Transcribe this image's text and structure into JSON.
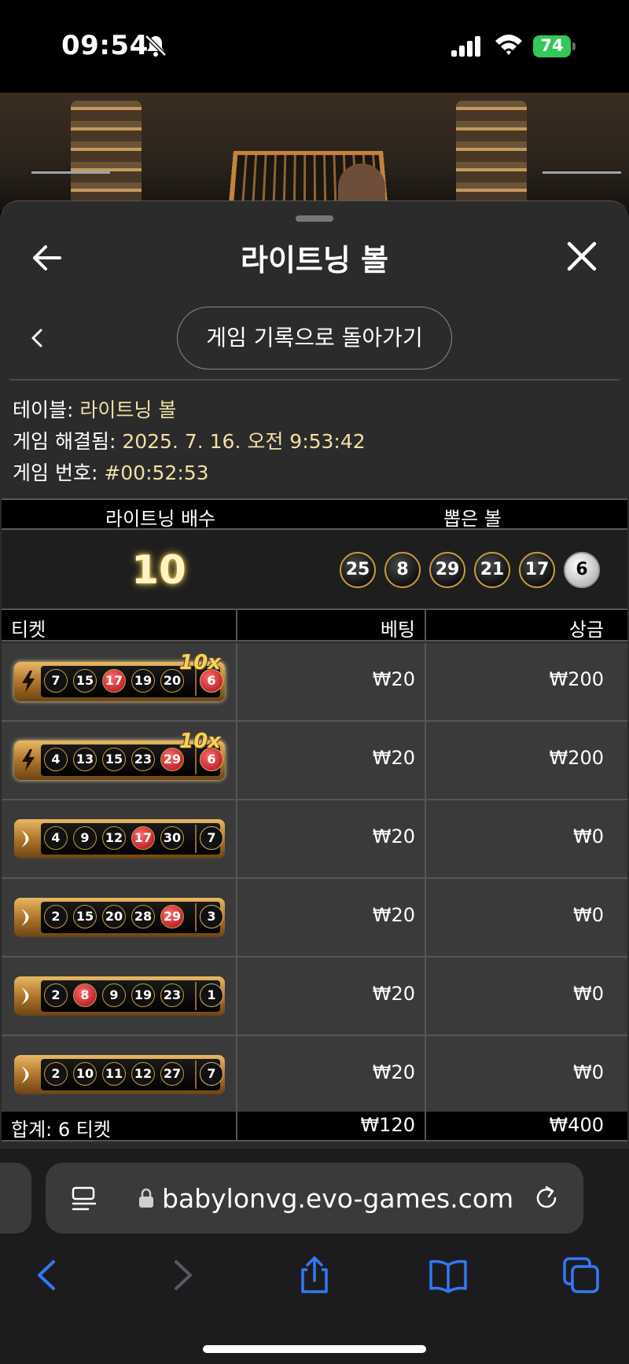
{
  "status_bar": {
    "time": "09:54",
    "battery": "74"
  },
  "panel": {
    "title": "라이트닝 볼",
    "history_button": "게임 기록으로 돌아가기",
    "info": [
      {
        "label": "테이블: ",
        "value": "라이트닝 볼"
      },
      {
        "label": "게임 해결됨: ",
        "value": "2025. 7. 16. 오전 9:53:42"
      },
      {
        "label": "게임 번호: ",
        "value": "#00:52:53"
      }
    ]
  },
  "draw": {
    "multiplier_header": "라이트닝 배수",
    "balls_header": "뽑은 볼",
    "multiplier": "10",
    "drawn_balls": [
      "25",
      "8",
      "29",
      "21",
      "17",
      "6"
    ]
  },
  "tickets": {
    "headers": {
      "ticket": "티켓",
      "bet": "베팅",
      "prize": "상금"
    },
    "rows": [
      {
        "type": "lightning",
        "badge": "10x",
        "numbers": [
          {
            "n": "7",
            "hit": false
          },
          {
            "n": "15",
            "hit": false
          },
          {
            "n": "17",
            "hit": true
          },
          {
            "n": "19",
            "hit": false
          },
          {
            "n": "20",
            "hit": false
          }
        ],
        "extra": {
          "n": "6",
          "hit": true
        },
        "bet": "₩20",
        "prize": "₩200"
      },
      {
        "type": "lightning",
        "badge": "10x",
        "numbers": [
          {
            "n": "4",
            "hit": false
          },
          {
            "n": "13",
            "hit": false
          },
          {
            "n": "15",
            "hit": false
          },
          {
            "n": "23",
            "hit": false
          },
          {
            "n": "29",
            "hit": true
          }
        ],
        "extra": {
          "n": "6",
          "hit": true
        },
        "bet": "₩20",
        "prize": "₩200"
      },
      {
        "type": "standard",
        "badge": "",
        "numbers": [
          {
            "n": "4",
            "hit": false
          },
          {
            "n": "9",
            "hit": false
          },
          {
            "n": "12",
            "hit": false
          },
          {
            "n": "17",
            "hit": true
          },
          {
            "n": "30",
            "hit": false
          }
        ],
        "extra": {
          "n": "7",
          "hit": false
        },
        "bet": "₩20",
        "prize": "₩0"
      },
      {
        "type": "standard",
        "badge": "",
        "numbers": [
          {
            "n": "2",
            "hit": false
          },
          {
            "n": "15",
            "hit": false
          },
          {
            "n": "20",
            "hit": false
          },
          {
            "n": "28",
            "hit": false
          },
          {
            "n": "29",
            "hit": true
          }
        ],
        "extra": {
          "n": "3",
          "hit": false
        },
        "bet": "₩20",
        "prize": "₩0"
      },
      {
        "type": "standard",
        "badge": "",
        "numbers": [
          {
            "n": "2",
            "hit": false
          },
          {
            "n": "8",
            "hit": true
          },
          {
            "n": "9",
            "hit": false
          },
          {
            "n": "19",
            "hit": false
          },
          {
            "n": "23",
            "hit": false
          }
        ],
        "extra": {
          "n": "1",
          "hit": false
        },
        "bet": "₩20",
        "prize": "₩0"
      },
      {
        "type": "standard",
        "badge": "",
        "numbers": [
          {
            "n": "2",
            "hit": false
          },
          {
            "n": "10",
            "hit": false
          },
          {
            "n": "11",
            "hit": false
          },
          {
            "n": "12",
            "hit": false
          },
          {
            "n": "27",
            "hit": false
          }
        ],
        "extra": {
          "n": "7",
          "hit": false
        },
        "bet": "₩20",
        "prize": "₩0"
      }
    ],
    "total": {
      "label": "합계: 6 티켓",
      "bet": "₩120",
      "prize": "₩400"
    }
  },
  "safari": {
    "url": "babylonvg.evo-games.com"
  },
  "colors": {
    "accent_gold": "#c69a3c",
    "hit_red": "#c0272d",
    "info_value": "#f2dfa8",
    "battery_green": "#35c759",
    "safari_blue": "#3478f6"
  }
}
